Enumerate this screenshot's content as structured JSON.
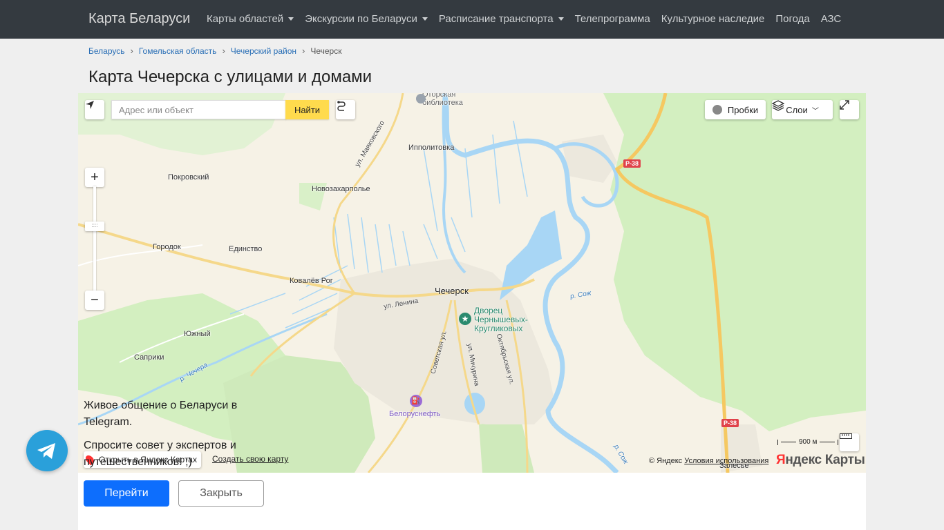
{
  "navbar": {
    "brand": "Карта Беларуси",
    "items": [
      {
        "label": "Карты областей",
        "dropdown": true
      },
      {
        "label": "Экскурсии по Беларуси",
        "dropdown": true
      },
      {
        "label": "Расписание транспорта",
        "dropdown": true
      },
      {
        "label": "Телепрограмма",
        "dropdown": false
      },
      {
        "label": "Культурное наследие",
        "dropdown": false
      },
      {
        "label": "Погода",
        "dropdown": false
      },
      {
        "label": "АЗС",
        "dropdown": false
      }
    ]
  },
  "breadcrumb": [
    "Беларусь",
    "Гомельская область",
    "Чечерский район",
    "Чечерск"
  ],
  "page_title": "Карта Чечерска с улицами и домами",
  "map": {
    "search_placeholder": "Адрес или объект",
    "search_button": "Найти",
    "traffic_button": "Пробки",
    "layers_button": "Слои",
    "labels": {
      "otorskaya": "Оторская\nбиблиотека",
      "ippolitovka": "Ипполитовка",
      "pokrovsky": "Покровский",
      "novozakharpolye": "Новозахарполье",
      "gorodok": "Городок",
      "edinstvo": "Единство",
      "kovalev_rog": "Ковалёв Рог",
      "chechersk": "Чечерск",
      "yuzhny": "Южный",
      "sapriki": "Саприки",
      "dvorets": "Дворец\nЧернышевых-\nКругликовых",
      "belorusneft": "Белоруснефть",
      "zalesye": "Залесье",
      "ul_lenina": "ул. Ленина",
      "ul_mayakovskogo": "ул. Маяковского",
      "ul_sovetskaya": "Советская ул.",
      "ul_michurina": "ул. Мичурина",
      "ul_oktyabrskaya": "Октябрьская ул.",
      "r_sozh_1": "р. Сож",
      "r_sozh_2": "р. Сож",
      "r_chechera": "р. Чечера",
      "road_r38_1": "Р-38",
      "road_r38_2": "Р-38"
    },
    "scale": "900 м",
    "copyright": "© Яндекс",
    "terms": "Условия использования",
    "logo_y": "Я",
    "logo_rest": "ндекс Карты",
    "open_yandex": "Открыть в Яндекс Картах",
    "create_map": "Создать свою карту"
  },
  "promo": {
    "line1": "Живое общение о Беларуси в Telegram.",
    "line2": "Спросите совет у экспертов и путешественников! ;)"
  },
  "buttons": {
    "go": "Перейти",
    "close": "Закрыть"
  },
  "colors": {
    "navbar": "#343a40",
    "primary": "#0d6efd",
    "telegram": "#2aa0da",
    "search_button": "#ffdb4d",
    "forest": "#d3efc0",
    "water": "#a8d6f5",
    "road_badge": "#e0424b"
  }
}
